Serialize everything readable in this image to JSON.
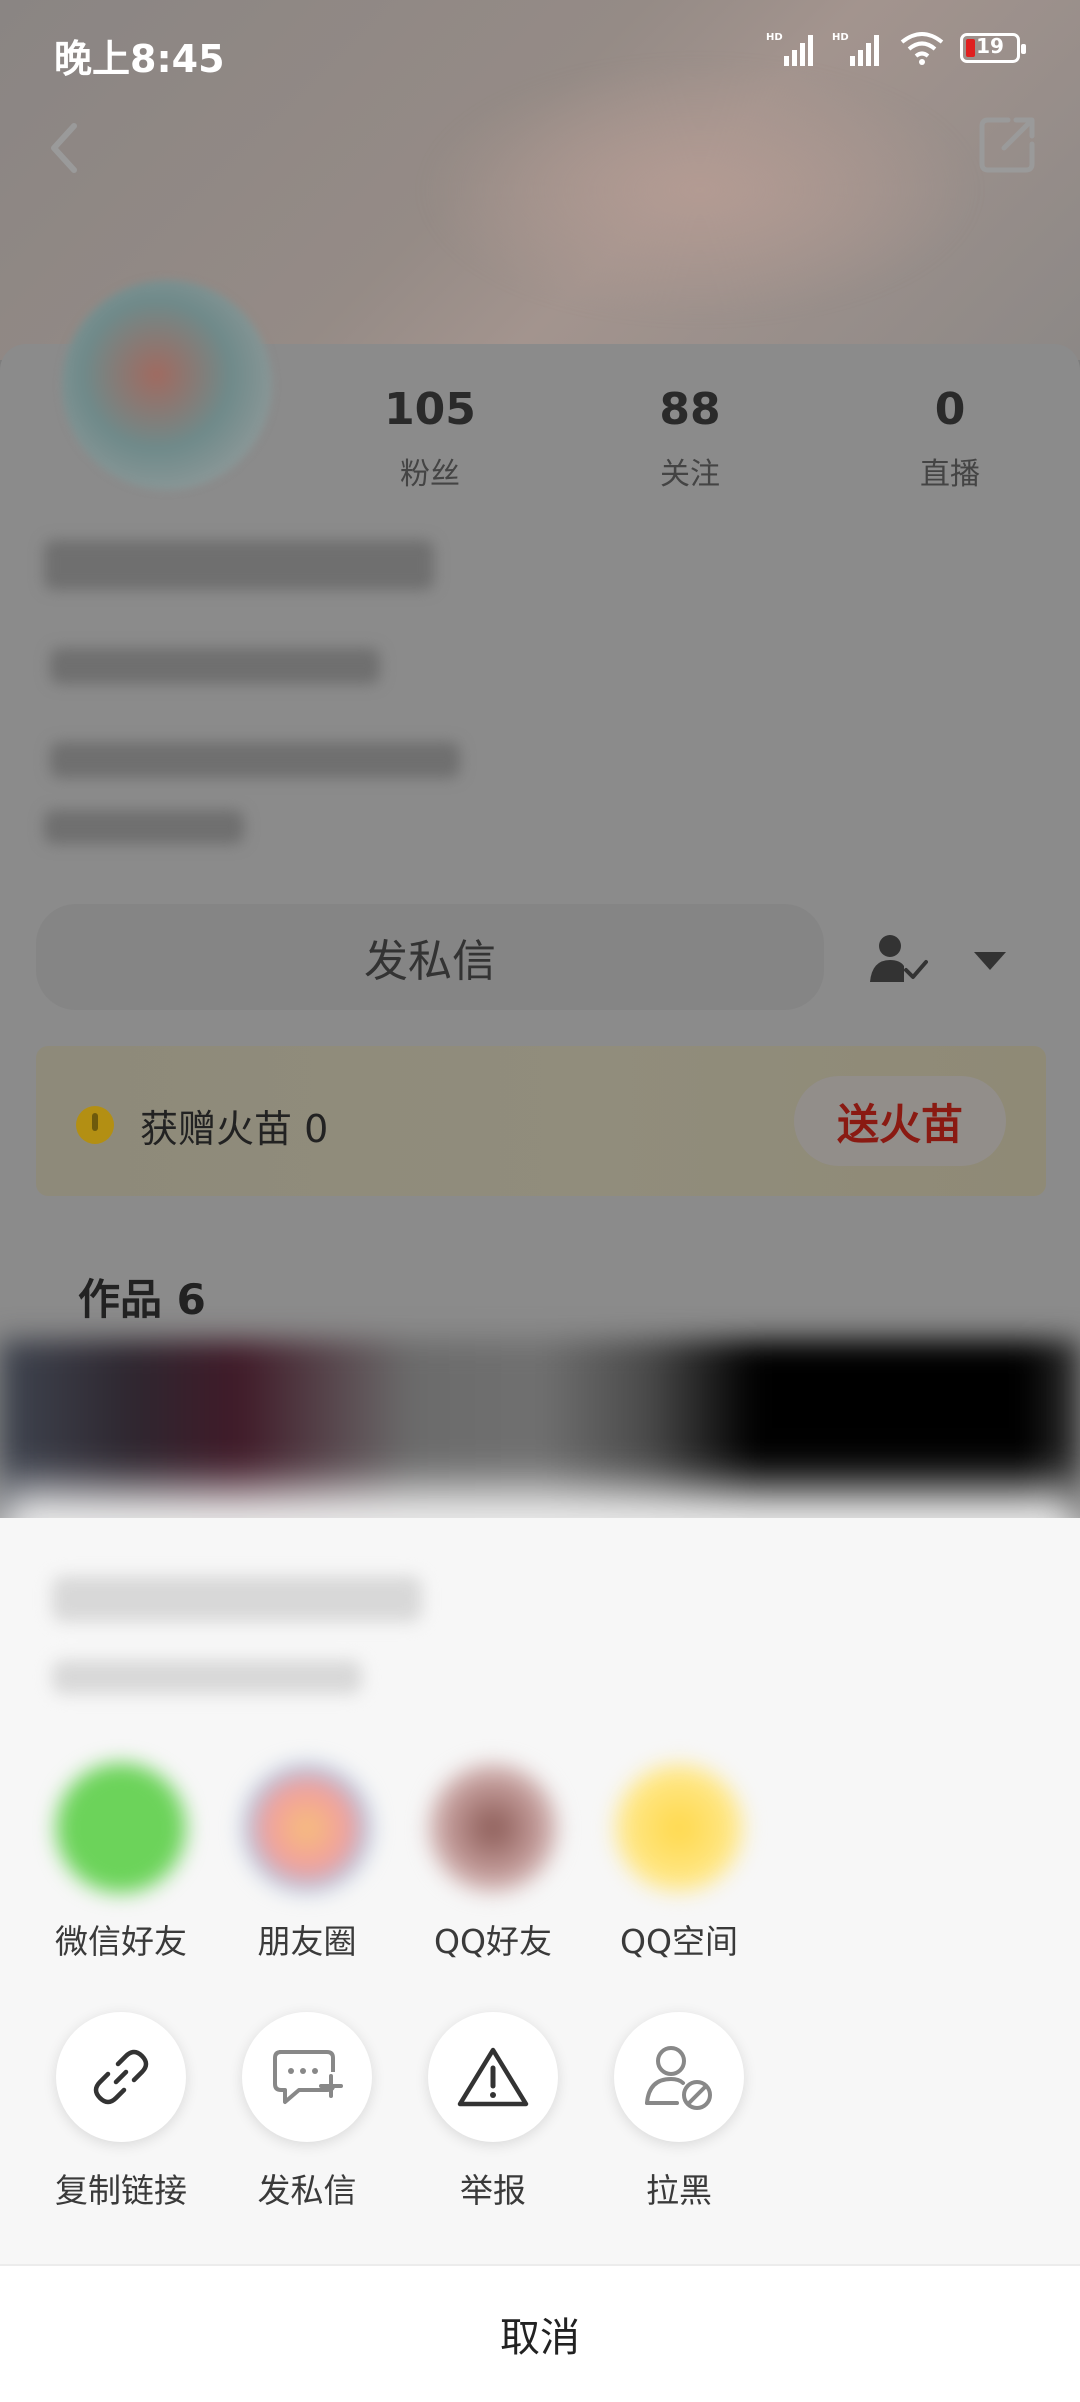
{
  "status_bar": {
    "time": "晚上8:45",
    "battery": "19"
  },
  "profile": {
    "stats": [
      {
        "value": "105",
        "label": "粉丝"
      },
      {
        "value": "88",
        "label": "关注"
      },
      {
        "value": "0",
        "label": "直播"
      }
    ],
    "message_button": "发私信",
    "flame": {
      "label": "获赠火苗 0",
      "send_button": "送火苗"
    },
    "works_title": "作品 6"
  },
  "share_sheet": {
    "share_targets": [
      {
        "label": "微信好友",
        "icon": "wechat-icon",
        "color": "#6cd35a"
      },
      {
        "label": "朋友圈",
        "icon": "moments-icon",
        "color": "#f2a0a0"
      },
      {
        "label": "QQ好友",
        "icon": "qq-icon",
        "color": "#a98080"
      },
      {
        "label": "QQ空间",
        "icon": "qzone-icon",
        "color": "#ffd84a"
      }
    ],
    "actions": [
      {
        "label": "复制链接",
        "icon": "link-icon"
      },
      {
        "label": "发私信",
        "icon": "message-add-icon"
      },
      {
        "label": "举报",
        "icon": "warning-icon"
      },
      {
        "label": "拉黑",
        "icon": "block-user-icon"
      }
    ],
    "cancel": "取消"
  }
}
